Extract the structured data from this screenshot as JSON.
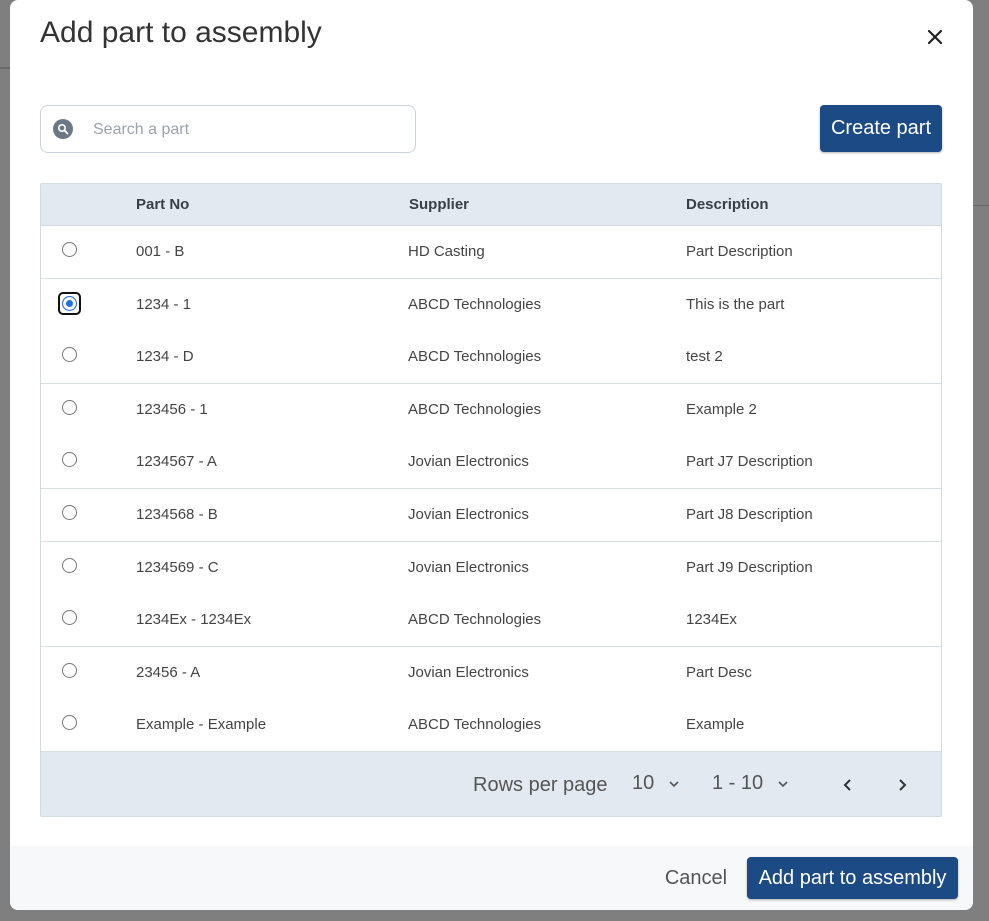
{
  "modal": {
    "title": "Add part to assembly",
    "close_icon": "close-icon"
  },
  "search": {
    "placeholder": "Search a part",
    "value": "",
    "icon": "search-icon"
  },
  "actions": {
    "create_label": "Create part",
    "cancel_label": "Cancel",
    "add_label": "Add part to assembly"
  },
  "table": {
    "headers": {
      "part_no": "Part No",
      "supplier": "Supplier",
      "description": "Description"
    },
    "selected_index": 1,
    "rows": [
      {
        "part_no": "001 - B",
        "supplier": "HD Casting",
        "description": "Part Description"
      },
      {
        "part_no": "1234 - 1",
        "supplier": "ABCD Technologies",
        "description": "This is the part"
      },
      {
        "part_no": "1234 - D",
        "supplier": "ABCD Technologies",
        "description": "test 2"
      },
      {
        "part_no": "123456 - 1",
        "supplier": "ABCD Technologies",
        "description": "Example 2"
      },
      {
        "part_no": "1234567 - A",
        "supplier": "Jovian Electronics",
        "description": "Part J7 Description"
      },
      {
        "part_no": "1234568 - B",
        "supplier": "Jovian Electronics",
        "description": "Part J8 Description"
      },
      {
        "part_no": "1234569 - C",
        "supplier": "Jovian Electronics",
        "description": "Part J9 Description"
      },
      {
        "part_no": "1234Ex - 1234Ex",
        "supplier": "ABCD Technologies",
        "description": "1234Ex"
      },
      {
        "part_no": "23456 - A",
        "supplier": "Jovian Electronics",
        "description": "Part Desc"
      },
      {
        "part_no": "Example - Example",
        "supplier": "ABCD Technologies",
        "description": "Example"
      }
    ]
  },
  "pagination": {
    "rows_per_page_label": "Rows per page",
    "rows_per_page": "10",
    "range": "1 - 10",
    "prev_icon": "chevron-left-icon",
    "next_icon": "chevron-right-icon"
  },
  "colors": {
    "primary": "#1c4a85",
    "header_bg": "#e3e9f1",
    "radio_selected": "#1f6fe5"
  }
}
